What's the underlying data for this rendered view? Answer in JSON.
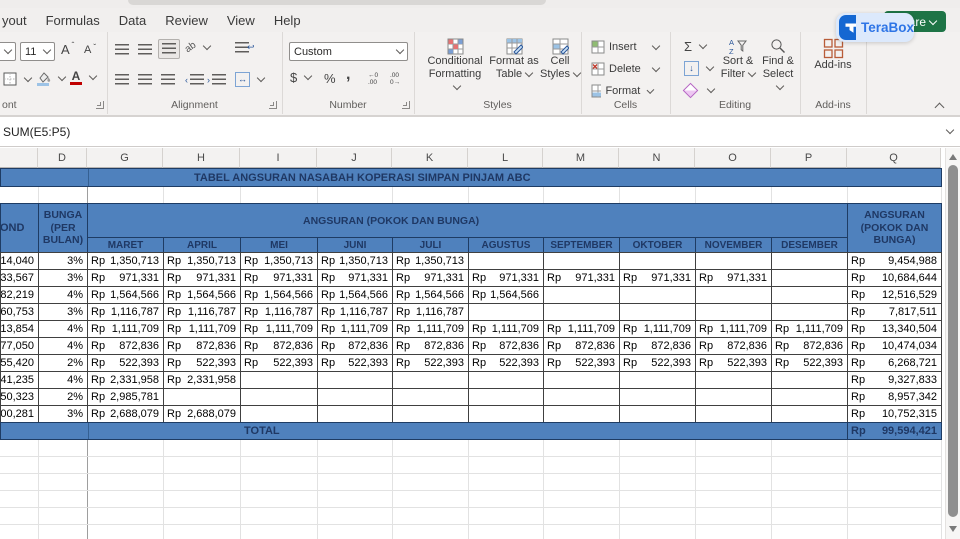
{
  "menu": {
    "tabs": [
      {
        "label": "yout"
      },
      {
        "label": "Formulas"
      },
      {
        "label": "Data"
      },
      {
        "label": "Review"
      },
      {
        "label": "View"
      },
      {
        "label": "Help"
      }
    ]
  },
  "ribbon": {
    "font": {
      "group": "ont",
      "size": "11"
    },
    "alignment": {
      "group": "Alignment"
    },
    "number": {
      "group": "Number",
      "format": "Custom"
    },
    "styles": {
      "group": "Styles",
      "b1a": "Conditional",
      "b1b": "Formatting",
      "b2a": "Format as",
      "b2b": "Table",
      "b3a": "Cell",
      "b3b": "Styles"
    },
    "cells": {
      "group": "Cells",
      "insert": "Insert",
      "del": "Delete",
      "format": "Format"
    },
    "editing": {
      "group": "Editing",
      "s1": "Sort &",
      "s2": "Filter",
      "f1": "Find &",
      "f2": "Select"
    },
    "addins": {
      "group": "Add-ins",
      "button": "Add-ins"
    }
  },
  "topright": {
    "share": "Share",
    "terabox": "TeraBox"
  },
  "formula_bar": {
    "value": "SUM(E5:P5)"
  },
  "sheet": {
    "columns": [
      {
        "letter": ""
      },
      {
        "letter": "D"
      },
      {
        "letter": "G"
      },
      {
        "letter": "H"
      },
      {
        "letter": "I"
      },
      {
        "letter": "J"
      },
      {
        "letter": "K"
      },
      {
        "letter": "L"
      },
      {
        "letter": "M"
      },
      {
        "letter": "N"
      },
      {
        "letter": "O"
      },
      {
        "letter": "P"
      },
      {
        "letter": "Q"
      }
    ],
    "title": "TABEL ANGSURAN NASABAH KOPERASI SIMPAN PINJAM ABC",
    "header": {
      "plafond_partial": "OND",
      "bunga_lines": [
        "BUNGA",
        "(PER",
        "BULAN)"
      ],
      "angsuran": "ANGSURAN (POKOK DAN BUNGA)",
      "months": [
        "MARET",
        "APRIL",
        "MEI",
        "JUNI",
        "JULI",
        "AGUSTUS",
        "SEPTEMBER",
        "OKTOBER",
        "NOVEMBER",
        "DESEMBER"
      ],
      "q_lines": [
        "ANGSURAN",
        "(POKOK DAN",
        "BUNGA)"
      ]
    },
    "currency": "Rp",
    "rows": [
      {
        "plafond": "14,040",
        "bunga": "3%",
        "amount": "1,350,713",
        "months_paid": 5,
        "total": "9,454,988"
      },
      {
        "plafond": "33,567",
        "bunga": "3%",
        "amount": "971,331",
        "months_paid": 9,
        "total": "10,684,644"
      },
      {
        "plafond": "82,219",
        "bunga": "4%",
        "amount": "1,564,566",
        "months_paid": 6,
        "total": "12,516,529"
      },
      {
        "plafond": "60,753",
        "bunga": "3%",
        "amount": "1,116,787",
        "months_paid": 5,
        "total": "7,817,511"
      },
      {
        "plafond": "13,854",
        "bunga": "4%",
        "amount": "1,111,709",
        "months_paid": 10,
        "total": "13,340,504"
      },
      {
        "plafond": "77,050",
        "bunga": "4%",
        "amount": "872,836",
        "months_paid": 10,
        "total": "10,474,034"
      },
      {
        "plafond": "55,420",
        "bunga": "2%",
        "amount": "522,393",
        "months_paid": 10,
        "total": "6,268,721"
      },
      {
        "plafond": "41,235",
        "bunga": "4%",
        "amount": "2,331,958",
        "months_paid": 2,
        "total": "9,327,833"
      },
      {
        "plafond": "50,323",
        "bunga": "2%",
        "amount": "2,985,781",
        "months_paid": 1,
        "total": "8,957,342"
      },
      {
        "plafond": "00,281",
        "bunga": "3%",
        "amount": "2,688,079",
        "months_paid": 2,
        "total": "10,752,315"
      }
    ],
    "total_label": "TOTAL",
    "grand_total": "99,594,421",
    "colors": {
      "header_blue": "#4F81BD",
      "header_text": "#1F3864"
    }
  }
}
